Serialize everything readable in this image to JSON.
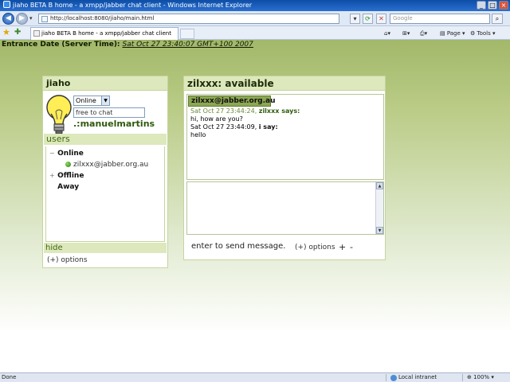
{
  "window": {
    "title": "jiaho BETA B home - a xmpp/jabber chat client - Windows Internet Explorer",
    "minimize": "_",
    "restore": "□",
    "close": "×"
  },
  "browser": {
    "url": "http://localhost:8080/jiaho/main.html",
    "search_placeholder": "Google",
    "tab_title": "jiaho BETA B home - a xmpp/jabber chat client",
    "page_menu": "Page",
    "tools_menu": "Tools"
  },
  "page": {
    "entrance_label": "Entrance Date (Server Time):",
    "entrance_value": "Sat Oct 27 23:40:07 GMT+100 2007"
  },
  "left_panel": {
    "title": "jiaho",
    "status_selected": "Online",
    "status_message": "free to chat",
    "my_name": ".:manuelmartins",
    "users_label": "users",
    "groups": [
      {
        "toggle": "−",
        "name": "Online"
      },
      {
        "toggle": "+",
        "name": "Offline"
      },
      {
        "toggle": "",
        "name": "Away"
      }
    ],
    "contacts": [
      {
        "jid": "zilxxx@jabber.org.au"
      }
    ],
    "hide_label": "hide",
    "options_label": "(+)  options"
  },
  "chat_panel": {
    "title": "zilxxx: available",
    "conversation_with": "zilxxx@jabber.org.au",
    "messages": [
      {
        "time": "Sat Oct 27 23:44:24,",
        "sender": "zilxxx says:",
        "text": "hi, how are you?"
      },
      {
        "time": "Sat Oct 27 23:44:09,",
        "sender": "i say:",
        "text": "hello"
      }
    ],
    "enter_hint": "enter to send message.",
    "options_label": "(+)  options",
    "plus_label": "+",
    "minus_label": "-"
  },
  "statusbar": {
    "done": "Done",
    "zone": "Local intranet",
    "zoom": "100%"
  },
  "colors": {
    "page_gradient_top": "#a3b86a",
    "panel_header": "#dde8bc",
    "accent_green": "#2f5a0c",
    "ie_titlebar": "#0d4ea6"
  }
}
